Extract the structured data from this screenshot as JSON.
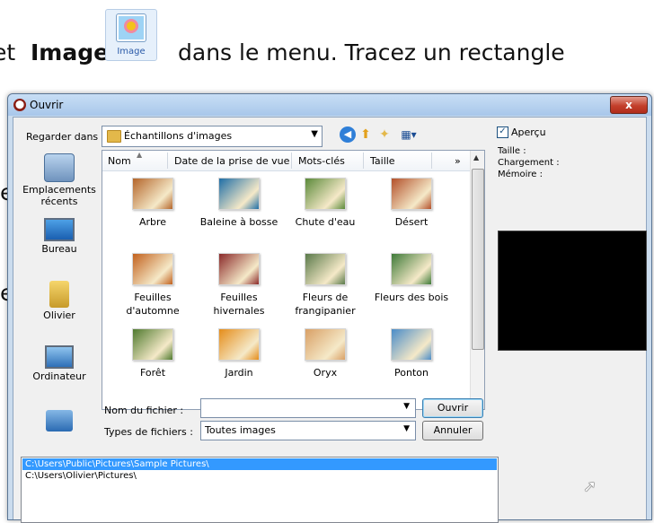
{
  "tutorial": {
    "prefix": "et",
    "bold": "Image",
    "rest": "dans le menu. Tracez un rectangle",
    "icon_caption": "Image",
    "fragment_1": "e",
    "fragment_2": "e"
  },
  "window": {
    "title": "Ouvrir",
    "close_label": "x"
  },
  "lookin": {
    "label": "Regarder dans :",
    "value": "Échantillons d'images"
  },
  "toolbar": {
    "icons": [
      "back-icon",
      "up-folder-icon",
      "new-folder-icon",
      "views-menu-icon"
    ]
  },
  "places": [
    {
      "label": "Emplacements récents",
      "icon": "recent-places-icon"
    },
    {
      "label": "Bureau",
      "icon": "desktop-icon"
    },
    {
      "label": "Olivier",
      "icon": "user-folder-icon"
    },
    {
      "label": "Ordinateur",
      "icon": "computer-icon"
    },
    {
      "label": "",
      "icon": "network-icon"
    }
  ],
  "columns": [
    "Nom",
    "Date de la prise de vue",
    "Mots-clés",
    "Taille",
    "»"
  ],
  "files": [
    {
      "label": "Arbre",
      "color": "#b4652a"
    },
    {
      "label": "Baleine à bosse",
      "color": "#1f6ea6"
    },
    {
      "label": "Chute d'eau",
      "color": "#5b8a3a"
    },
    {
      "label": "Désert",
      "color": "#b3502a"
    },
    {
      "label": "Feuilles d'automne",
      "color": "#c2611d"
    },
    {
      "label": "Feuilles hivernales",
      "color": "#8b2a2a"
    },
    {
      "label": "Fleurs de frangipanier",
      "color": "#5a7a4a"
    },
    {
      "label": "Fleurs des bois",
      "color": "#3e7a38"
    },
    {
      "label": "Forêt",
      "color": "#4f7a2e"
    },
    {
      "label": "Jardin",
      "color": "#e58d1a"
    },
    {
      "label": "Oryx",
      "color": "#d9a066"
    },
    {
      "label": "Ponton",
      "color": "#4a8cc8"
    }
  ],
  "filename": {
    "label": "Nom du fichier :",
    "value": ""
  },
  "filetype": {
    "label": "Types de fichiers :",
    "value": "Toutes images"
  },
  "buttons": {
    "open": "Ouvrir",
    "cancel": "Annuler"
  },
  "preview": {
    "checkbox_label": "Aperçu",
    "checked": true,
    "size_label": "Taille :",
    "loading_label": "Chargement :",
    "memory_label": "Mémoire :"
  },
  "paths": [
    {
      "text": "C:\\Users\\Public\\Pictures\\Sample Pictures\\",
      "selected": true
    },
    {
      "text": "C:\\Users\\Olivier\\Pictures\\",
      "selected": false
    }
  ]
}
